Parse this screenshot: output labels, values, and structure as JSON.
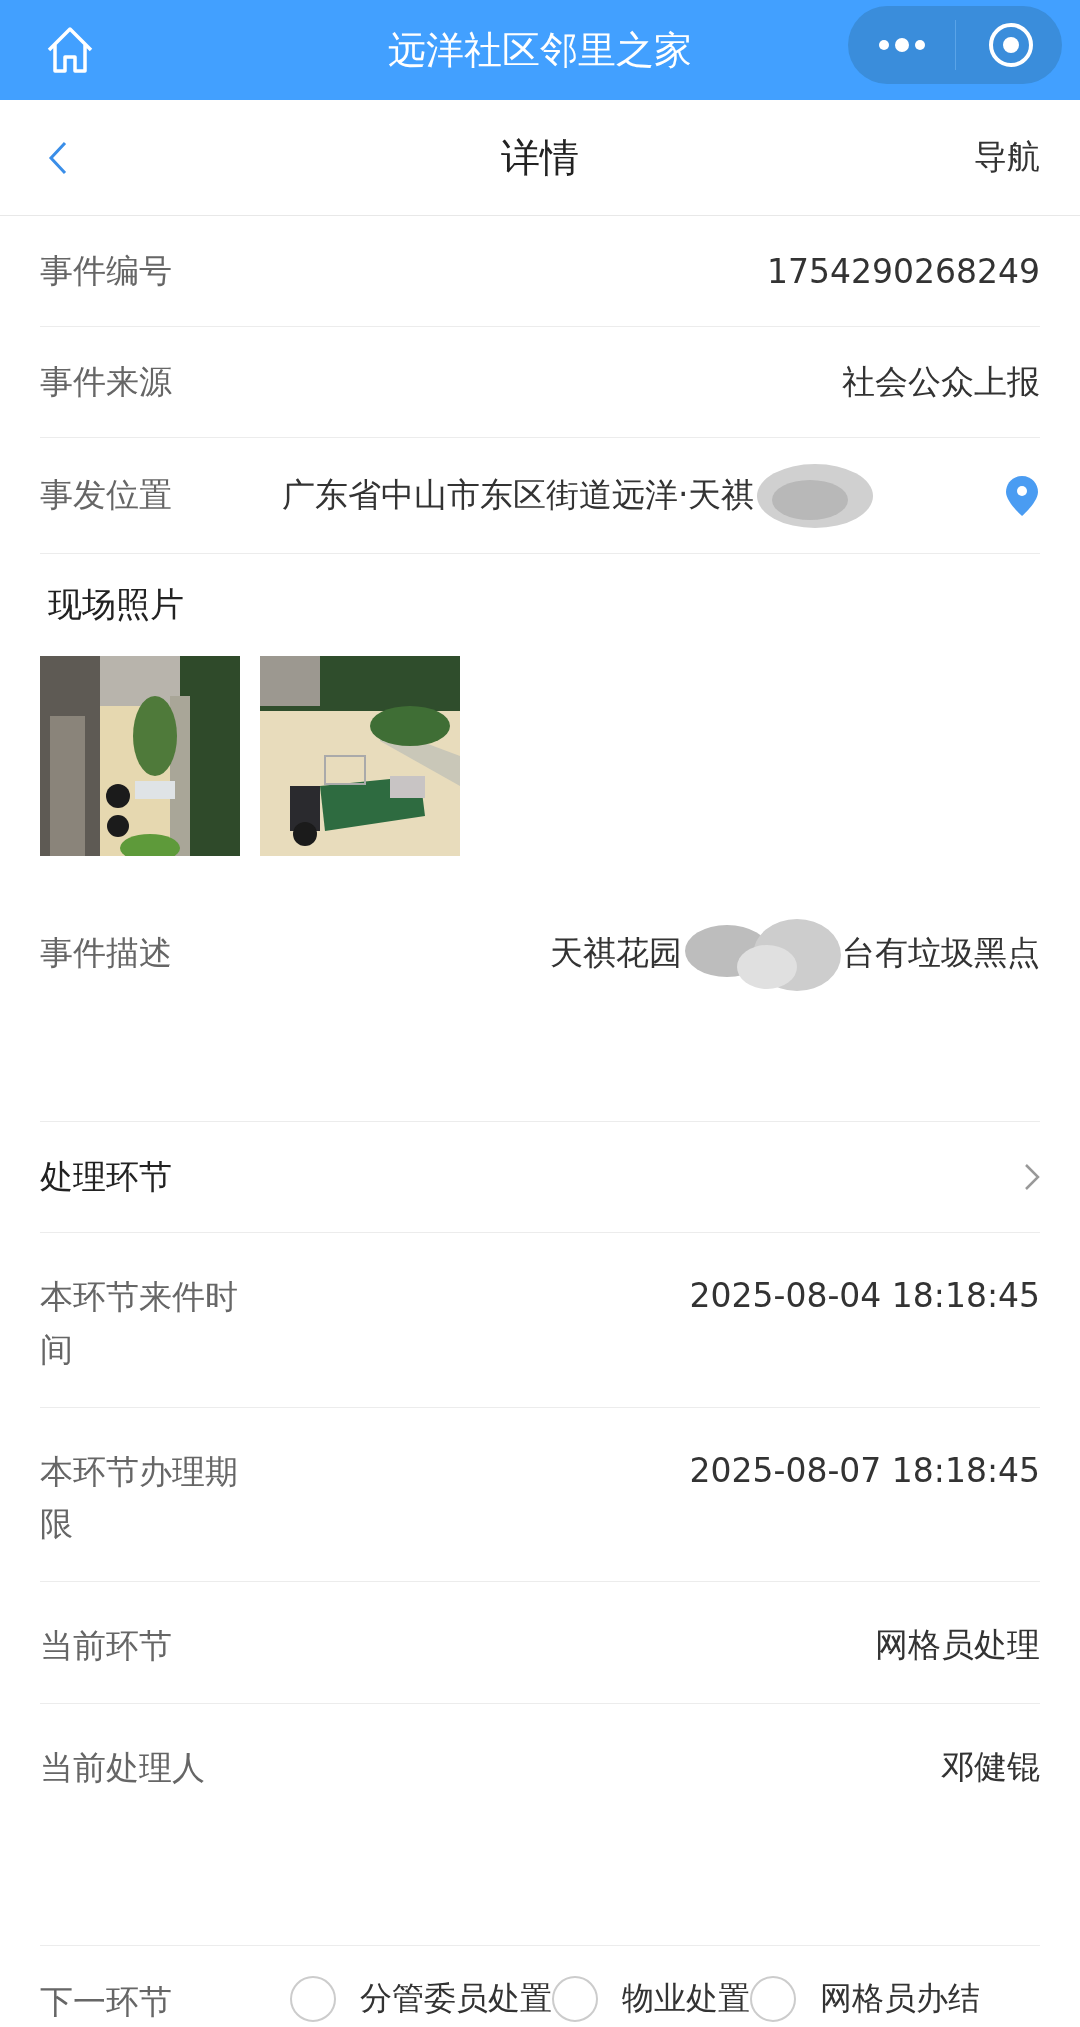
{
  "app_bar": {
    "title": "远洋社区邻里之家"
  },
  "header": {
    "title": "详情",
    "action": "导航"
  },
  "fields": [
    {
      "label": "事件编号",
      "value": "1754290268249"
    },
    {
      "label": "事件来源",
      "value": "社会公众上报"
    }
  ],
  "location": {
    "label": "事发位置",
    "value": "广东省中山市东区街道远洋·天祺"
  },
  "photos": {
    "title": "现场照片"
  },
  "description": {
    "label": "事件描述",
    "value_start": "天祺花园",
    "value_end": "台有垃圾黑点"
  },
  "process": {
    "title": "处理环节"
  },
  "process_fields": [
    {
      "label": "本环节来件时间",
      "value": "2025-08-04 18:18:45"
    },
    {
      "label": "本环节办理期限",
      "value": "2025-08-07 18:18:45"
    },
    {
      "label": "当前环节",
      "value": "网格员处理"
    },
    {
      "label": "当前处理人",
      "value": "邓健锟"
    }
  ],
  "next_step": {
    "label": "下一环节",
    "options": [
      {
        "label": "分管委员处置",
        "selected": false
      },
      {
        "label": "物业处置",
        "selected": false
      },
      {
        "label": "网格员办结",
        "selected": false
      }
    ]
  }
}
